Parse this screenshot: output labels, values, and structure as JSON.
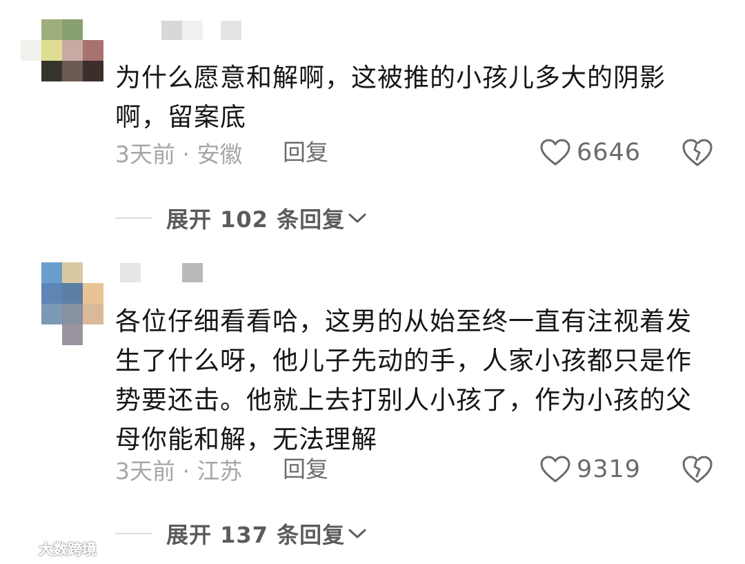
{
  "comments": [
    {
      "text": "为什么愿意和解啊，这被推的小孩儿多大的阴影啊，留案底",
      "meta": "3天前 · 安徽",
      "reply_label": "回复",
      "like_count": "6646",
      "expand_label": "展开 102 条回复",
      "avatar_colors": [
        "#ffffff",
        "#9fae7a",
        "#89a06f",
        "#ffffff",
        "#f0f0ec",
        "#dfdd91",
        "#c9a9a4",
        "#a8736f",
        "#ffffff",
        "#36352c",
        "#6d5a55",
        "#3b2e2c",
        "#ffffff",
        "#ffffff",
        "#ffffff",
        "#ffffff"
      ]
    },
    {
      "text": "各位仔细看看哈，这男的从始至终一直有注视着发生了什么呀，他儿子先动的手，人家小孩都只是作势要还击。他就上去打别人小孩了，作为小孩的父母你能和解，无法理解",
      "meta": "3天前 · 江苏",
      "reply_label": "回复",
      "like_count": "9319",
      "expand_label": "展开 137 条回复",
      "avatar_colors": [
        "#ffffff",
        "#6a9fcc",
        "#d9c9a3",
        "#ffffff",
        "#ffffff",
        "#5d86b7",
        "#5c7ea4",
        "#e8c495",
        "#ffffff",
        "#7b99b4",
        "#8791a0",
        "#d9b997",
        "#ffffff",
        "#ffffff",
        "#9a93a0",
        "#ffffff"
      ]
    }
  ],
  "watermark": "大数跨境",
  "colors": {
    "text": "#161616",
    "meta": "#a6a6a6",
    "secondary": "#6a6a6a",
    "divider": "#dcdcdc"
  }
}
